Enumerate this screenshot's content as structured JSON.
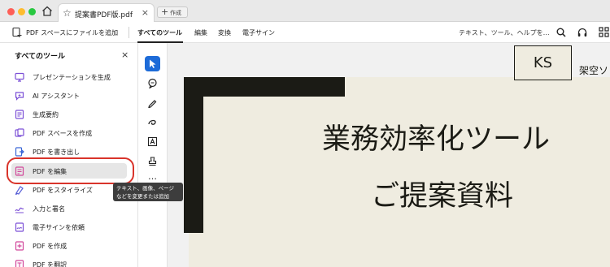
{
  "titlebar": {
    "traffic_colors": [
      "#fe5f57",
      "#febc2e",
      "#28c840"
    ],
    "tab_title": "提案書PDF版.pdf",
    "tab_close": "×",
    "new_tab_plus": "+",
    "new_tab_label": "作成"
  },
  "toolbar": {
    "add_to_space": "PDF スペースにファイルを追加",
    "menu": [
      "すべてのツール",
      "編集",
      "変換",
      "電子サイン"
    ],
    "search_placeholder": "テキスト、ツール、ヘルプを…"
  },
  "sidebar": {
    "title": "すべてのツール",
    "close": "×",
    "items": [
      {
        "label": "プレゼンテーションを生成",
        "icon": "presentation-icon",
        "color": "#7b4fd6"
      },
      {
        "label": "AI アシスタント",
        "icon": "ai-assistant-icon",
        "color": "#7b4fd6"
      },
      {
        "label": "生成要約",
        "icon": "summary-icon",
        "color": "#7b4fd6"
      },
      {
        "label": "PDF スペースを作成",
        "icon": "pdf-space-icon",
        "color": "#7b4fd6"
      },
      {
        "label": "PDF を書き出し",
        "icon": "export-pdf-icon",
        "color": "#3a66d6"
      },
      {
        "label": "PDF を編集",
        "icon": "edit-pdf-icon",
        "color": "#d1469a"
      },
      {
        "label": "PDF をスタイライズ",
        "icon": "stylize-icon",
        "color": "#5b63d9"
      },
      {
        "label": "入力と署名",
        "icon": "fill-sign-icon",
        "color": "#7b4fd6"
      },
      {
        "label": "電子サインを依頼",
        "icon": "request-esign-icon",
        "color": "#7b4fd6"
      },
      {
        "label": "PDF を作成",
        "icon": "create-pdf-icon",
        "color": "#d1469a"
      },
      {
        "label": "PDF を翻訳",
        "icon": "translate-icon",
        "color": "#d1469a"
      }
    ],
    "selected_index": 5,
    "highlight_color": "#d9342b"
  },
  "rail": {
    "tools": [
      "select-icon",
      "comment-icon",
      "pen-icon",
      "draw-icon",
      "text-box-icon",
      "stamp-icon",
      "more-icon"
    ],
    "more_label": "…",
    "active_color": "#1d6bd8"
  },
  "tooltip": {
    "line1": "テキスト、画像、ページ",
    "line2": "などを変更または追加"
  },
  "document": {
    "logo_text": "KS",
    "company_text": "架空ソ",
    "title_line1": "業務効率化ツール",
    "title_line2": "ご提案資料",
    "page_color": "#efece0",
    "ink_color": "#1b1b15"
  }
}
